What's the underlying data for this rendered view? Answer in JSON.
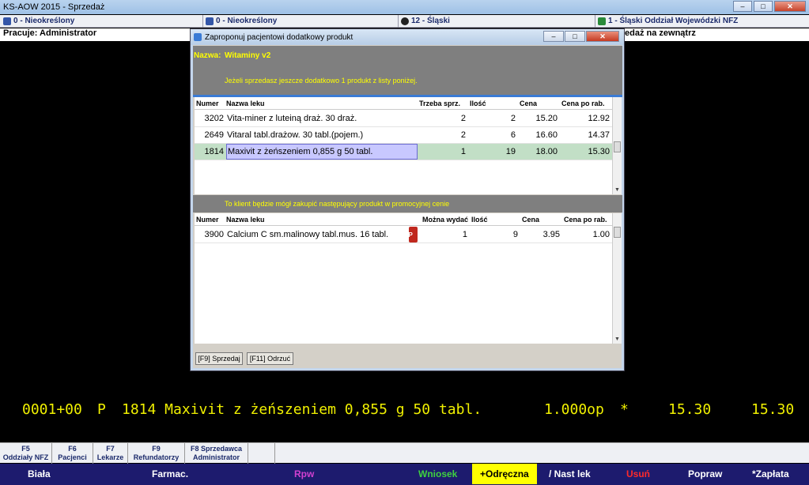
{
  "app": {
    "title": "KS-AOW 2015 - Sprzedaż",
    "controls": {
      "minimize": "–",
      "maximize": "□",
      "close": "✕"
    }
  },
  "infobar": {
    "item1": "0 - Nieokreślony",
    "item2": "0 - Nieokreślony",
    "item3": "12 - Śląski",
    "item4": "1 - Śląski Oddział Wojewódzki NFZ",
    "partial_right": "edaż na zewnątrz"
  },
  "pracuje": "Pracuje: Administrator",
  "dialog": {
    "title": "Zaproponuj pacjentowi dodatkowy produkt",
    "nazwa_label": "Nazwa:",
    "nazwa_value": "Witaminy v2",
    "instruction": "Jeżeli sprzedasz jeszcze dodatkowo 1 produkt z listy poniżej.",
    "table1": {
      "headers": [
        "Numer",
        "Nazwa leku",
        "Trzeba sprz.",
        "Ilość",
        "Cena",
        "Cena po rab."
      ],
      "rows": [
        {
          "numer": "3202",
          "nazwa": "Vita-miner z luteiną draż. 30 draż.",
          "trzeba": "2",
          "ilosc": "2",
          "cena": "15.20",
          "cena_rab": "12.92"
        },
        {
          "numer": "2649",
          "nazwa": "Vitaral tabl.drażow. 30 tabl.(pojem.)",
          "trzeba": "2",
          "ilosc": "6",
          "cena": "16.60",
          "cena_rab": "14.37"
        },
        {
          "numer": "1814",
          "nazwa": "Maxivit z żeńszeniem 0,855 g 50 tabl.",
          "trzeba": "1",
          "ilosc": "19",
          "cena": "18.00",
          "cena_rab": "15.30"
        }
      ]
    },
    "promo_text": "To klient będzie mógł zakupić następujący produkt w promocyjnej cenie",
    "table2": {
      "headers": [
        "Numer",
        "Nazwa leku",
        "Można wydać",
        "Ilość",
        "Cena",
        "Cena po rab."
      ],
      "rows": [
        {
          "numer": "3900",
          "nazwa": "Calcium C sm.malinowy  tabl.mus. 16 tabl.",
          "badge": "P",
          "mozna": "1",
          "ilosc": "9",
          "cena": "3.95",
          "cena_rab": "1.00"
        }
      ]
    },
    "buttons": {
      "sprzedaj": "[F9] Sprzedaj",
      "odrzuc": "[F11] Odrzuć"
    }
  },
  "bigline": {
    "code": "0001+00",
    "type": "P",
    "item": "1814 Maxivit z żeńszeniem 0,855 g 50 tabl.",
    "qty": "1.000op",
    "star": "*",
    "price": "15.30",
    "total": "15.30"
  },
  "fkeys": [
    {
      "key": "F5",
      "label": "Oddziały NFZ"
    },
    {
      "key": "F6",
      "label": "Pacjenci"
    },
    {
      "key": "F7",
      "label": "Lekarze"
    },
    {
      "key": "F9",
      "label": "Refundatorzy"
    },
    {
      "key": "F8 Sprzedawca",
      "label": "Administrator"
    }
  ],
  "bottom": {
    "biala": "Biała",
    "farmac": "Farmac.",
    "rpw": "Rpw",
    "wniosek": "Wniosek",
    "odreczna": "+Odręczna",
    "nast_lek": "/ Nast lek",
    "usun": "Usuń",
    "popraw": "Popraw",
    "zaplata": "*Zapłata"
  },
  "colors": {
    "yellow": "#ffff00",
    "rpw": "#d040d0",
    "wniosek": "#3fd13f",
    "usun": "#ff2a2a",
    "bottom_bg": "#1d1b6e"
  }
}
